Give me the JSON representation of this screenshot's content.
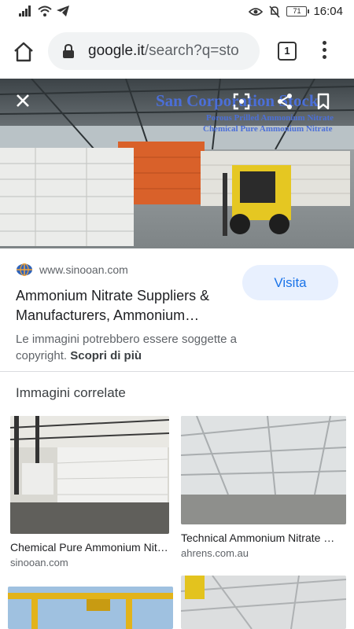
{
  "status_bar": {
    "time": "16:04",
    "battery": "71",
    "icons": [
      "signal-icon",
      "wifi-icon",
      "telegram-icon",
      "eye-icon",
      "bell-off-icon",
      "battery-icon"
    ]
  },
  "browser": {
    "url_domain": "google.it",
    "url_path": "/search?q=sto",
    "tab_count": "1"
  },
  "hero": {
    "overlay_title": "San Corporation Stock",
    "overlay_line1": "Porous Prilled Ammonium Nitrate",
    "overlay_line2": "Chemical Pure Ammonium Nitrate"
  },
  "result": {
    "source": "www.sinooan.com",
    "visit_label": "Visita",
    "title": "Ammonium Nitrate Suppliers & Manufacturers, Ammonium…",
    "note": "Le immagini potrebbero essere soggette a copyright.",
    "note_link": "Scopri di più"
  },
  "related": {
    "heading": "Immagini correlate",
    "items": [
      {
        "caption": "Chemical Pure Ammonium Nit…",
        "domain": "sinooan.com"
      },
      {
        "caption": "Technical Ammonium Nitrate …",
        "domain": "ahrens.com.au"
      }
    ]
  },
  "colors": {
    "accent": "#1a73e8",
    "visit_bg": "#e8f0fe",
    "url_bg": "#f1f3f4"
  }
}
